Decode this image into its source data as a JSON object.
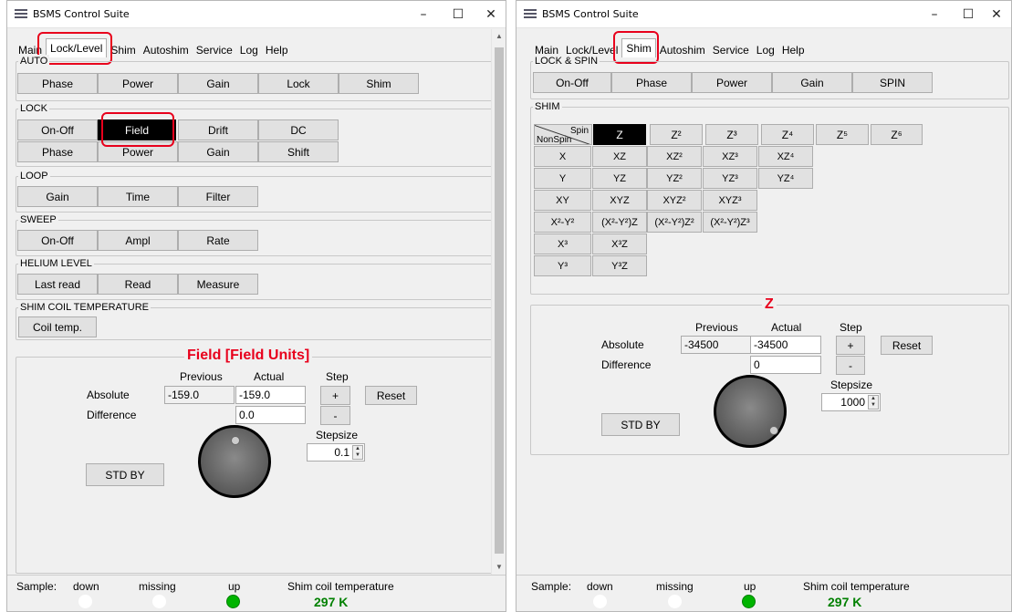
{
  "colors": {
    "accent": "#e8001c",
    "led_on": "#00b400",
    "temp_text": "#008000",
    "selected_button": "#000000"
  },
  "left": {
    "title": "BSMS Control Suite",
    "controls": {
      "minimize": "–",
      "maximize": "☐",
      "close": "✕"
    },
    "tabs": [
      "Main",
      "Lock/Level",
      "Shim",
      "Autoshim",
      "Service",
      "Log",
      "Help"
    ],
    "active_tab": "Lock/Level",
    "groups": {
      "auto": {
        "title": "AUTO",
        "buttons": [
          "Phase",
          "Power",
          "Gain",
          "Lock",
          "Shim"
        ]
      },
      "lock": {
        "title": "LOCK",
        "row1": [
          "On-Off",
          "Field",
          "Drift",
          "DC"
        ],
        "row2": [
          "Phase",
          "Power",
          "Gain",
          "Shift"
        ],
        "selected": "Field"
      },
      "loop": {
        "title": "LOOP",
        "buttons": [
          "Gain",
          "Time",
          "Filter"
        ]
      },
      "sweep": {
        "title": "SWEEP",
        "buttons": [
          "On-Off",
          "Ampl",
          "Rate"
        ]
      },
      "helium": {
        "title": "HELIUM LEVEL",
        "buttons": [
          "Last read",
          "Read",
          "Measure"
        ]
      },
      "shimcoil": {
        "title": "SHIM COIL TEMPERATURE",
        "buttons": [
          "Coil temp."
        ]
      }
    },
    "control": {
      "title": "Field [Field Units]",
      "previous_label": "Previous",
      "actual_label": "Actual",
      "step_label": "Step",
      "absolute_label": "Absolute",
      "difference_label": "Difference",
      "previous_value": "-159.0",
      "actual_value": "-159.0",
      "difference_value": "0.0",
      "plus": "+",
      "minus": "-",
      "reset": "Reset",
      "stepsize_label": "Stepsize",
      "stepsize_value": "0.1",
      "stdby": "STD BY"
    },
    "status": {
      "sample_label": "Sample:",
      "down": "down",
      "missing": "missing",
      "up": "up",
      "shim_temp_label": "Shim coil temperature",
      "shim_temp_value": "297 K"
    }
  },
  "right": {
    "title": "BSMS Control Suite",
    "controls": {
      "minimize": "–",
      "maximize": "☐",
      "close": "✕"
    },
    "tabs": [
      "Main",
      "Lock/Level",
      "Shim",
      "Autoshim",
      "Service",
      "Log",
      "Help"
    ],
    "active_tab": "Shim",
    "lockspin": {
      "title": "LOCK & SPIN",
      "buttons": [
        "On-Off",
        "Phase",
        "Power",
        "Gain",
        "SPIN"
      ]
    },
    "shim": {
      "title": "SHIM",
      "spin_label": "Spin",
      "nonspin_label": "NonSpin",
      "spin_row": [
        "Z",
        "Z²",
        "Z³",
        "Z⁴",
        "Z⁵",
        "Z⁶"
      ],
      "rows": [
        [
          "X",
          "XZ",
          "XZ²",
          "XZ³",
          "XZ⁴"
        ],
        [
          "Y",
          "YZ",
          "YZ²",
          "YZ³",
          "YZ⁴"
        ],
        [
          "XY",
          "XYZ",
          "XYZ²",
          "XYZ³"
        ],
        [
          "X²-Y²",
          "(X²-Y²)Z",
          "(X²-Y²)Z²",
          "(X²-Y²)Z³"
        ],
        [
          "X³",
          "X³Z"
        ],
        [
          "Y³",
          "Y³Z"
        ]
      ],
      "selected": "Z"
    },
    "control": {
      "title": "Z",
      "previous_label": "Previous",
      "actual_label": "Actual",
      "step_label": "Step",
      "absolute_label": "Absolute",
      "difference_label": "Difference",
      "previous_value": "-34500",
      "actual_value": "-34500",
      "difference_value": "0",
      "plus": "+",
      "minus": "-",
      "reset": "Reset",
      "stepsize_label": "Stepsize",
      "stepsize_value": "1000",
      "stdby": "STD BY"
    },
    "status": {
      "sample_label": "Sample:",
      "down": "down",
      "missing": "missing",
      "up": "up",
      "shim_temp_label": "Shim coil temperature",
      "shim_temp_value": "297 K"
    }
  }
}
